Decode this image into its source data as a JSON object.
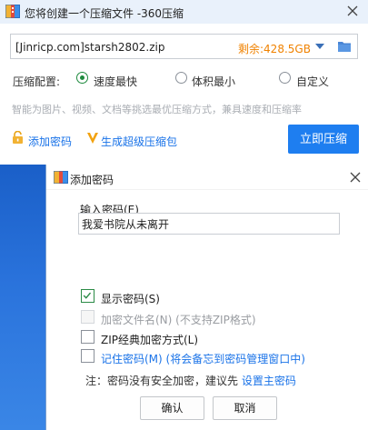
{
  "main_window": {
    "title": "您将创建一个压缩文件 -360压缩",
    "path_value": "[Jinricp.com]starsh2802.zip",
    "free_space": "剩余:428.5GB",
    "config_label": "压缩配置:",
    "options": [
      {
        "label": "速度最快",
        "selected": true
      },
      {
        "label": "体积最小",
        "selected": false
      },
      {
        "label": "自定义",
        "selected": false
      }
    ],
    "hint": "智能为图片、视频、文档等挑选最优压缩方式，兼具速度和压缩率",
    "add_password_link": "添加密码",
    "super_package_link": "生成超级压缩包",
    "compress_button": "立即压缩"
  },
  "dialog": {
    "title": "添加密码",
    "password_label": "输入密码(E)",
    "password_value": "我爱书院从未离开",
    "checkboxes": [
      {
        "label": "显示密码(S)",
        "checked": true,
        "disabled": false,
        "style": "normal"
      },
      {
        "label": "加密文件名(N) (不支持ZIP格式)",
        "checked": false,
        "disabled": true,
        "style": "dim"
      },
      {
        "label": "ZIP经典加密方式(L)",
        "checked": false,
        "disabled": false,
        "style": "normal"
      },
      {
        "label": "记住密码(M) (将会备忘到密码管理窗口中)",
        "checked": false,
        "disabled": false,
        "style": "blue"
      }
    ],
    "note_text": "注：密码没有安全加密，建议先 ",
    "note_link": "设置主密码",
    "ok_button": "确认",
    "cancel_button": "取消"
  },
  "colors": {
    "accent": "#1e7ef0",
    "link": "#1a73e8",
    "free_space": "#f08200",
    "radio_selected": "#1e8a3e"
  }
}
